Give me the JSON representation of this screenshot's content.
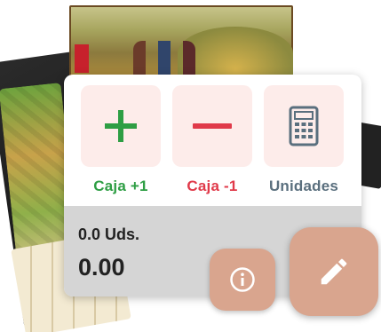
{
  "background": {
    "image_icon": "board-game-photo"
  },
  "actions": [
    {
      "label": "Caja +1",
      "icon": "plus-icon",
      "color": "#2e9e44"
    },
    {
      "label": "Caja -1",
      "icon": "minus-icon",
      "color": "#e03a4a"
    },
    {
      "label": "Unidades",
      "icon": "calculator-icon",
      "color": "#5a6f7e"
    }
  ],
  "status": {
    "units": "0.0 Uds.",
    "total": "0.00"
  },
  "fabs": {
    "info_icon": "info-icon",
    "edit_icon": "pencil-icon",
    "color": "#d9a58e"
  }
}
